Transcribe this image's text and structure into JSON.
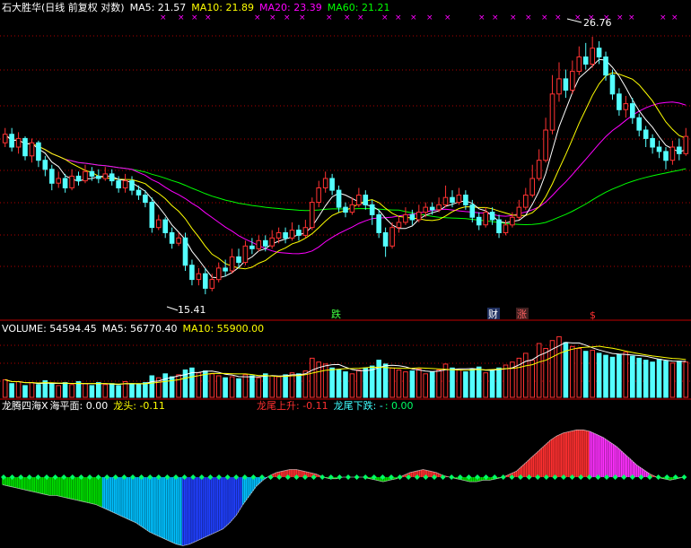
{
  "colors": {
    "bg": "#000000",
    "up": "#ff3232",
    "down": "#54ffff",
    "ma5": "#ffffff",
    "ma10": "#ffff00",
    "ma20": "#ff00ff",
    "ma60": "#00ff00",
    "grid": "#b00000",
    "vol_ma10": "#ffff00",
    "dragon_pos": "#ff3030",
    "dragon_pos2": "#ff30ff",
    "dragon_neg": "#00e000",
    "dragon_neg2": "#2040ff",
    "dragon_neg3": "#00c0ff",
    "sea": "#00ff66"
  },
  "price_header": {
    "title": "石大胜华(日线 前复权 对数)",
    "ma5": "MA5: 21.57",
    "ma10": "MA10: 21.89",
    "ma20": "MA20: 23.39",
    "ma60": "MA60: 21.21"
  },
  "volume_header": {
    "volume": "VOLUME: 54594.45",
    "ma5": "MA5: 56770.40",
    "ma10": "MA10: 55900.00"
  },
  "indicator_header": {
    "name": "龙腾四海X",
    "sea_level": "海平面: 0.00",
    "dragon_head": "龙头: -0.11",
    "tail_up": "龙尾上升: -0.11",
    "tail_down": "龙尾下跌: -",
    "tail_zero": ": 0.00"
  },
  "annotations": {
    "high_label": "26.76",
    "low_label": "15.41",
    "event_fall": "跌",
    "event_finance": "财",
    "event_rise": "涨",
    "event_s": "$"
  },
  "chart_data": {
    "type": "candlestick",
    "title": "石大胜华(日线 前复权 对数)",
    "ylim": [
      14.5,
      28.0
    ],
    "scale": "log",
    "grid": "horizontal dashed",
    "high_marker": 26.76,
    "low_marker": 15.41,
    "candles": [
      [
        21.2,
        21.6,
        21.9,
        21.0
      ],
      [
        21.6,
        21.0,
        21.9,
        20.8
      ],
      [
        21.0,
        21.4,
        21.7,
        20.7
      ],
      [
        21.4,
        20.6,
        21.5,
        20.4
      ],
      [
        20.6,
        21.2,
        21.4,
        20.3
      ],
      [
        21.2,
        20.4,
        21.3,
        20.1
      ],
      [
        20.4,
        20.0,
        20.6,
        19.7
      ],
      [
        20.0,
        19.4,
        20.2,
        19.1
      ],
      [
        19.4,
        19.6,
        19.9,
        19.2
      ],
      [
        19.6,
        19.2,
        19.8,
        19.0
      ],
      [
        19.2,
        19.7,
        20.0,
        19.1
      ],
      [
        19.7,
        19.5,
        19.9,
        19.3
      ],
      [
        19.5,
        19.9,
        20.2,
        19.4
      ],
      [
        19.9,
        19.7,
        20.1,
        19.5
      ],
      [
        19.7,
        19.6,
        20.0,
        19.4
      ],
      [
        19.6,
        19.8,
        20.1,
        19.5
      ],
      [
        19.8,
        19.5,
        20.0,
        19.3
      ],
      [
        19.5,
        19.2,
        19.7,
        19.0
      ],
      [
        19.2,
        19.5,
        19.8,
        19.0
      ],
      [
        19.5,
        19.1,
        19.7,
        18.9
      ],
      [
        19.1,
        18.9,
        19.3,
        18.7
      ],
      [
        18.9,
        18.6,
        19.1,
        18.4
      ],
      [
        18.6,
        17.6,
        18.8,
        17.4
      ],
      [
        17.6,
        17.9,
        18.1,
        17.5
      ],
      [
        17.9,
        17.4,
        18.0,
        17.2
      ],
      [
        17.4,
        17.0,
        17.6,
        16.8
      ],
      [
        17.0,
        17.2,
        17.4,
        16.9
      ],
      [
        17.2,
        16.2,
        17.4,
        16.0
      ],
      [
        16.2,
        15.7,
        16.4,
        15.5
      ],
      [
        15.7,
        15.9,
        16.1,
        15.5
      ],
      [
        15.9,
        15.4,
        16.1,
        15.2
      ],
      [
        15.4,
        15.7,
        15.9,
        15.3
      ],
      [
        15.7,
        16.1,
        16.3,
        15.6
      ],
      [
        16.1,
        16.0,
        16.4,
        15.8
      ],
      [
        16.0,
        16.5,
        16.8,
        15.9
      ],
      [
        16.5,
        16.3,
        16.8,
        16.1
      ],
      [
        16.3,
        16.9,
        17.1,
        16.2
      ],
      [
        16.9,
        16.8,
        17.2,
        16.6
      ],
      [
        16.8,
        17.1,
        17.3,
        16.7
      ],
      [
        17.1,
        16.9,
        17.3,
        16.7
      ],
      [
        16.9,
        17.2,
        17.5,
        16.8
      ],
      [
        17.2,
        17.4,
        17.6,
        17.0
      ],
      [
        17.4,
        17.2,
        17.6,
        17.0
      ],
      [
        17.2,
        17.5,
        17.8,
        17.1
      ],
      [
        17.5,
        17.3,
        17.7,
        17.1
      ],
      [
        17.3,
        17.6,
        17.9,
        17.2
      ],
      [
        17.6,
        18.6,
        18.8,
        17.5
      ],
      [
        18.6,
        19.2,
        19.5,
        18.4
      ],
      [
        19.2,
        19.6,
        19.9,
        19.0
      ],
      [
        19.6,
        19.1,
        19.8,
        18.9
      ],
      [
        19.1,
        18.4,
        19.3,
        18.2
      ],
      [
        18.4,
        18.2,
        18.6,
        18.0
      ],
      [
        18.2,
        18.5,
        18.8,
        18.1
      ],
      [
        18.5,
        18.9,
        19.2,
        18.4
      ],
      [
        18.9,
        18.5,
        19.1,
        18.3
      ],
      [
        18.5,
        18.1,
        18.7,
        17.7
      ],
      [
        18.1,
        17.4,
        18.3,
        17.2
      ],
      [
        17.4,
        16.9,
        17.6,
        16.5
      ],
      [
        16.9,
        17.6,
        17.8,
        16.8
      ],
      [
        17.6,
        17.8,
        18.0,
        17.4
      ],
      [
        17.8,
        18.1,
        18.4,
        17.7
      ],
      [
        18.1,
        17.9,
        18.3,
        17.7
      ],
      [
        17.9,
        18.2,
        18.5,
        17.8
      ],
      [
        18.2,
        18.4,
        18.6,
        18.0
      ],
      [
        18.4,
        18.3,
        18.6,
        18.1
      ],
      [
        18.3,
        18.5,
        18.8,
        18.2
      ],
      [
        18.5,
        18.8,
        19.3,
        18.4
      ],
      [
        18.8,
        18.6,
        19.1,
        18.4
      ],
      [
        18.6,
        18.9,
        19.2,
        18.5
      ],
      [
        18.9,
        18.5,
        19.1,
        18.3
      ],
      [
        18.5,
        18.0,
        18.7,
        17.8
      ],
      [
        18.0,
        17.7,
        18.2,
        17.5
      ],
      [
        17.7,
        18.2,
        18.4,
        17.6
      ],
      [
        18.2,
        17.9,
        18.4,
        17.7
      ],
      [
        17.9,
        17.4,
        18.1,
        17.2
      ],
      [
        17.4,
        17.7,
        17.9,
        17.3
      ],
      [
        17.7,
        18.0,
        18.2,
        17.6
      ],
      [
        18.0,
        18.4,
        18.7,
        17.9
      ],
      [
        18.4,
        18.9,
        19.2,
        18.3
      ],
      [
        18.9,
        19.6,
        20.2,
        18.8
      ],
      [
        19.6,
        20.4,
        20.9,
        19.5
      ],
      [
        20.4,
        21.8,
        22.4,
        20.3
      ],
      [
        21.8,
        23.6,
        24.6,
        21.6
      ],
      [
        23.6,
        24.4,
        25.3,
        23.2
      ],
      [
        24.4,
        23.8,
        24.9,
        23.4
      ],
      [
        23.8,
        24.8,
        25.4,
        23.6
      ],
      [
        24.8,
        25.6,
        26.2,
        24.6
      ],
      [
        25.6,
        25.2,
        26.4,
        24.9
      ],
      [
        25.2,
        26.1,
        26.76,
        25.0
      ],
      [
        26.1,
        25.6,
        26.5,
        25.2
      ],
      [
        25.6,
        24.6,
        25.9,
        24.3
      ],
      [
        24.6,
        23.6,
        24.9,
        23.3
      ],
      [
        23.6,
        22.8,
        23.9,
        22.5
      ],
      [
        22.8,
        23.1,
        23.5,
        22.4
      ],
      [
        23.1,
        22.4,
        23.4,
        22.1
      ],
      [
        22.4,
        21.8,
        22.6,
        21.5
      ],
      [
        21.8,
        21.4,
        22.0,
        21.0
      ],
      [
        21.4,
        21.0,
        21.6,
        20.7
      ],
      [
        21.0,
        20.8,
        21.3,
        20.5
      ],
      [
        20.8,
        20.4,
        21.0,
        20.0
      ],
      [
        20.4,
        21.0,
        21.3,
        20.2
      ],
      [
        21.0,
        20.7,
        21.4,
        20.4
      ],
      [
        20.7,
        21.5,
        21.9,
        20.6
      ]
    ],
    "volume": [
      18,
      14,
      16,
      12,
      15,
      13,
      17,
      14,
      12,
      15,
      13,
      16,
      14,
      12,
      15,
      13,
      14,
      12,
      16,
      14,
      13,
      15,
      22,
      20,
      24,
      21,
      23,
      28,
      30,
      25,
      27,
      24,
      22,
      20,
      21,
      19,
      23,
      22,
      20,
      24,
      22,
      21,
      23,
      25,
      24,
      27,
      40,
      36,
      34,
      30,
      28,
      26,
      24,
      28,
      30,
      32,
      38,
      34,
      30,
      28,
      26,
      27,
      29,
      24,
      26,
      28,
      34,
      30,
      28,
      26,
      29,
      31,
      25,
      27,
      30,
      33,
      36,
      40,
      45,
      38,
      55,
      50,
      58,
      62,
      56,
      52,
      50,
      47,
      48,
      45,
      43,
      41,
      44,
      46,
      42,
      40,
      38,
      36,
      39,
      37,
      35,
      37,
      36
    ],
    "indicator": [
      -0.05,
      -0.06,
      -0.07,
      -0.08,
      -0.09,
      -0.1,
      -0.11,
      -0.12,
      -0.12,
      -0.13,
      -0.14,
      -0.15,
      -0.16,
      -0.17,
      -0.18,
      -0.2,
      -0.22,
      -0.24,
      -0.26,
      -0.28,
      -0.3,
      -0.33,
      -0.36,
      -0.38,
      -0.4,
      -0.42,
      -0.44,
      -0.45,
      -0.44,
      -0.42,
      -0.4,
      -0.38,
      -0.36,
      -0.34,
      -0.3,
      -0.25,
      -0.18,
      -0.12,
      -0.06,
      -0.02,
      0.01,
      0.03,
      0.04,
      0.05,
      0.05,
      0.04,
      0.03,
      0.02,
      0.0,
      -0.01,
      -0.01,
      0.0,
      0.0,
      0.0,
      0.0,
      -0.01,
      -0.02,
      -0.03,
      -0.02,
      -0.01,
      0.01,
      0.03,
      0.04,
      0.05,
      0.04,
      0.03,
      0.01,
      0.0,
      -0.01,
      -0.02,
      -0.03,
      -0.03,
      -0.02,
      -0.02,
      -0.01,
      0.0,
      0.02,
      0.04,
      0.08,
      0.12,
      0.16,
      0.2,
      0.24,
      0.27,
      0.29,
      0.3,
      0.31,
      0.31,
      0.3,
      0.28,
      0.26,
      0.23,
      0.2,
      0.16,
      0.12,
      0.08,
      0.05,
      0.02,
      0.0,
      -0.01,
      -0.02,
      -0.01,
      0.0
    ]
  }
}
